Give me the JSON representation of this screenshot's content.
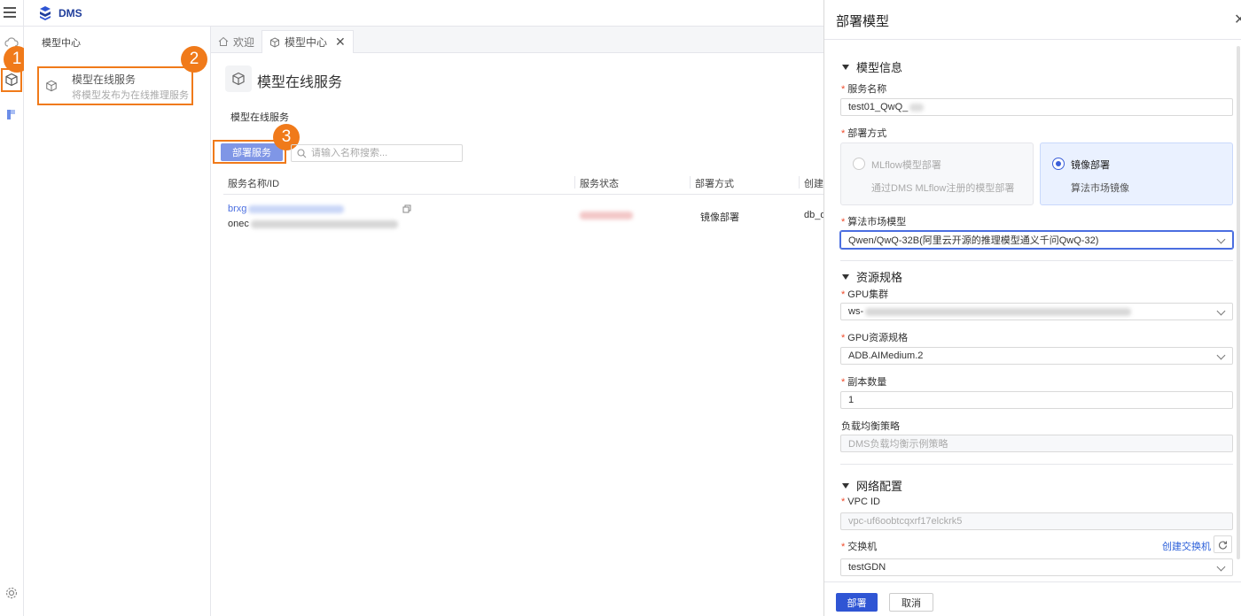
{
  "app": {
    "logo_text": "DMS"
  },
  "sidebar": {
    "title": "模型中心",
    "item": {
      "title": "模型在线服务",
      "desc": "将模型发布为在线推理服务"
    }
  },
  "steps": [
    "1",
    "2",
    "3"
  ],
  "tabs": [
    {
      "label": "欢迎"
    },
    {
      "label": "模型中心"
    }
  ],
  "main": {
    "page_title": "模型在线服务",
    "sub_tab": "模型在线服务",
    "deploy_button": "部署服务",
    "search_placeholder": "请输入名称搜索...",
    "columns": [
      "服务名称/ID",
      "服务状态",
      "部署方式",
      "创建"
    ],
    "row": {
      "name_prefix": "brxg",
      "id_prefix": "onec",
      "deploy_mode": "镜像部署",
      "created_prefix": "db_d"
    }
  },
  "drawer": {
    "title": "部署模型",
    "sections": {
      "model_info": "模型信息",
      "resource": "资源规格",
      "network": "网络配置"
    },
    "labels": {
      "service_name": "服务名称",
      "deploy_mode": "部署方式",
      "market_model": "算法市场模型",
      "gpu_cluster": "GPU集群",
      "gpu_spec": "GPU资源规格",
      "replicas": "副本数量",
      "lb_policy": "负载均衡策略",
      "vpc_id": "VPC ID",
      "vswitch": "交换机"
    },
    "values": {
      "service_name": "test01_QwQ_",
      "market_model": "Qwen/QwQ-32B(阿里云开源的推理模型通义千问QwQ-32)",
      "gpu_cluster_prefix": "ws-",
      "gpu_spec": "ADB.AIMedium.2",
      "replicas": "1",
      "vpc_id": "vpc-uf6oobtcqxrf17elckrk5",
      "vswitch": "testGDN"
    },
    "placeholders": {
      "lb_policy": "DMS负载均衡示例策略"
    },
    "deploy_options": [
      {
        "title": "MLflow模型部署",
        "desc": "通过DMS MLflow注册的模型部署",
        "selected": false
      },
      {
        "title": "镜像部署",
        "desc": "算法市场镜像",
        "selected": true
      }
    ],
    "create_vswitch_link": "创建交换机",
    "footer": {
      "confirm": "部署",
      "cancel": "取消"
    }
  },
  "colors": {
    "accent": "#2f55d4",
    "highlight": "#f07a1a",
    "required": "#f04b2b"
  }
}
